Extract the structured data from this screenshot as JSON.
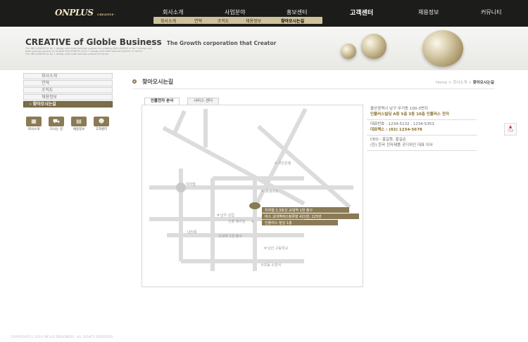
{
  "header": {
    "logo_text": "ONPLUS",
    "logo_sub": "CREATIVE ·",
    "nav": [
      "회사소개",
      "사업분야",
      "홍보센터",
      "고객센터",
      "채용정보",
      "커뮤니티"
    ],
    "active_nav_index": 3,
    "subnav": [
      "회사소개",
      "연혁",
      "조직도",
      "채용정보",
      "찾아오시는길"
    ],
    "active_subnav_index": 4
  },
  "banner": {
    "title_em": "CREATIVE",
    "title_rest": " of Globle Business",
    "tagline": "The Growth corporation that Creator",
    "fine_print": [
      "The INFLUSNESS lit for 1 design with total solution partner for creating INFLUSNESS lit for 1 design and",
      "total solution partner in Growth INFLUSNESS lit for 1 design and total solution partner in future",
      "The INFLUSNESS lit for 1 design with total solution partner lit future"
    ]
  },
  "sidebar": {
    "items": [
      "회사소개",
      "연혁",
      "조직도",
      "채용정보",
      "찾아오시는길"
    ],
    "active_index": 4,
    "active_prefix": "›",
    "quick_links": [
      {
        "label": "회사소개",
        "icon": "building-icon",
        "glyph": "▦"
      },
      {
        "label": "오시는 길",
        "icon": "car-icon",
        "glyph": "⛟"
      },
      {
        "label": "채용정보",
        "icon": "document-icon",
        "glyph": "▤"
      },
      {
        "label": "고객센터",
        "icon": "people-icon",
        "glyph": "☻"
      }
    ]
  },
  "content": {
    "title": "찾아오시는길",
    "breadcrumb": {
      "home": "Home",
      "sep": ">",
      "section": "회사소개",
      "current": "찾아오시는길"
    },
    "tabs": [
      "인플전자 본사",
      "서비스 센터"
    ],
    "active_tab_index": 0
  },
  "map": {
    "labels": {
      "bank": "국민은행",
      "station": "지하철",
      "kb": "롯데마트",
      "namu": "남우 상업",
      "office": "인플 메이잉",
      "nadang": "내당동",
      "exit": "교대역 1번 출구",
      "school": "남산 고등학교",
      "fire": "서초동 소방서"
    },
    "callouts": [
      "지하철 2,3호선 교대역 1번 출구",
      "버스 교대역버스정류장 421번, 125번",
      "인플러스 빌딩 1층"
    ]
  },
  "info": {
    "address": [
      "울산광역시 남구 무거동 100-3번지",
      "인플러스빌딩 A동 5층 3동 10층 인플러스 전자"
    ],
    "phone": "대표번호 : 1234-5132 , 1234-5353",
    "fax": "대표팩스 : (02) 1234-5678",
    "ceo": "CEO : 홍길동, 홍길순",
    "ceo_note": "(한) 한국 전자제품 굿디자인 대표 이사"
  },
  "top_button": "TOP",
  "footer": {
    "copyright": "COPYRIGHT(C) 2010 INFLUS DESIGNERS. ALL RIGHTS RESERVED."
  },
  "colors": {
    "accent": "#8a7a55",
    "header_bg": "#1c1c1a",
    "highlight": "#7c6d4b"
  }
}
